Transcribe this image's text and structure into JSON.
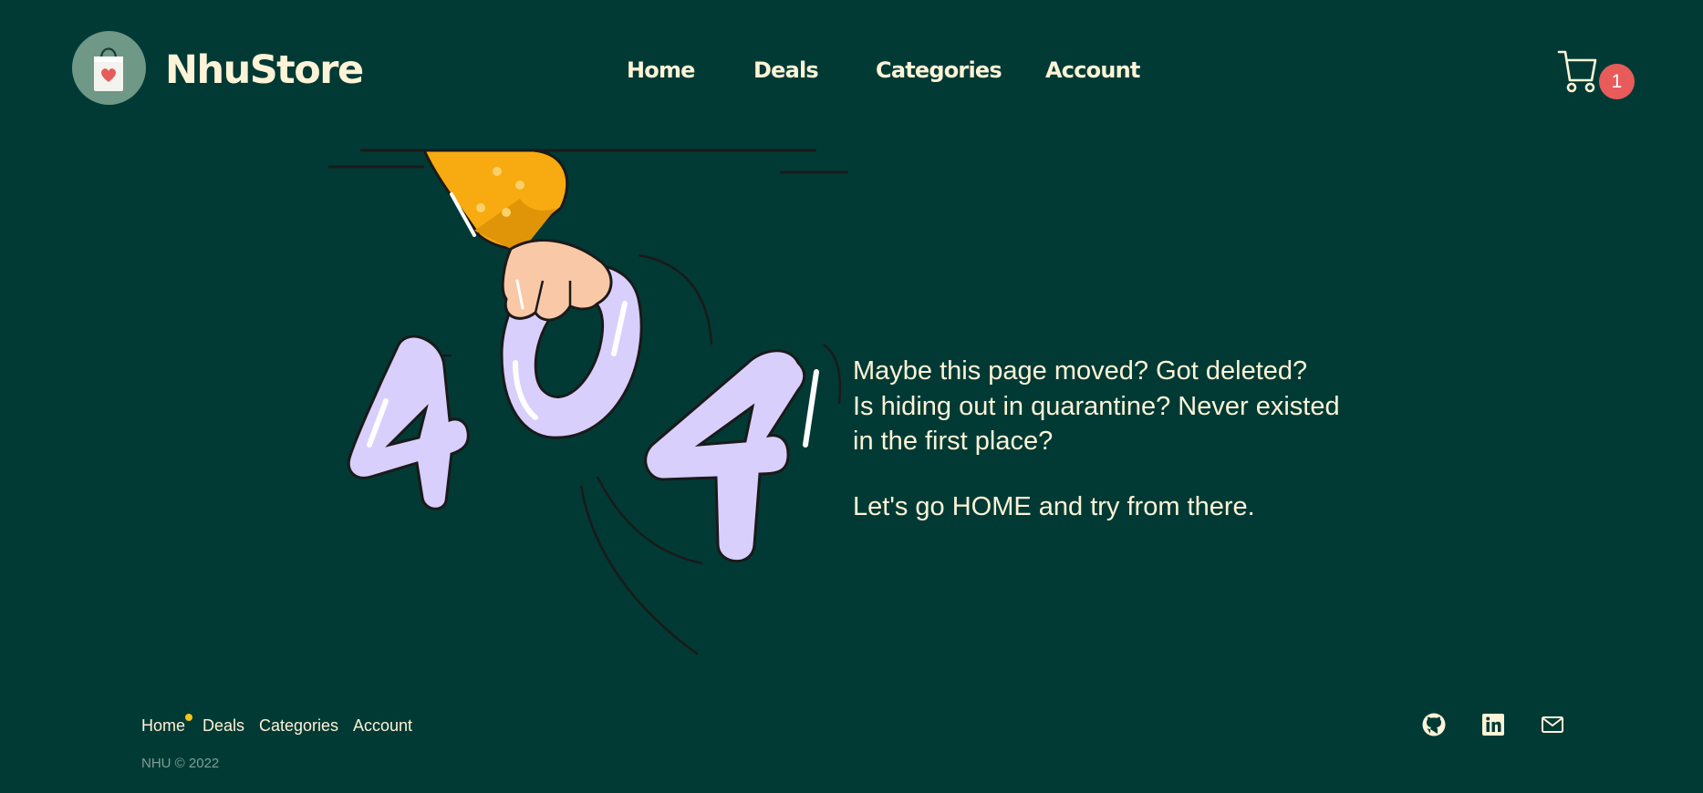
{
  "header": {
    "brand": "NhuStore",
    "nav": [
      {
        "label": "Home"
      },
      {
        "label": "Deals"
      },
      {
        "label": "Categories"
      },
      {
        "label": "Account"
      }
    ],
    "cart_count": "1"
  },
  "illustration": {
    "digits": [
      "4",
      "0",
      "4"
    ]
  },
  "message": {
    "line1": "Maybe this page moved? Got deleted?",
    "line2": "Is hiding out in quarantine? Never existed",
    "line3": "in the first place?",
    "cta": "Let's go HOME and try from there."
  },
  "footer": {
    "links": [
      {
        "label": "Home"
      },
      {
        "label": "Deals"
      },
      {
        "label": "Categories"
      },
      {
        "label": "Account"
      }
    ],
    "copyright": "NHU © 2022",
    "social": [
      {
        "icon": "github-icon"
      },
      {
        "icon": "linkedin-icon"
      },
      {
        "icon": "mail-icon"
      }
    ]
  },
  "colors": {
    "background": "#013a35",
    "text": "#fdf3d6",
    "badge": "#e85b5b",
    "accent": "#f5c518",
    "digits": "#d8cffc",
    "sleeve": "#f7ab10"
  }
}
